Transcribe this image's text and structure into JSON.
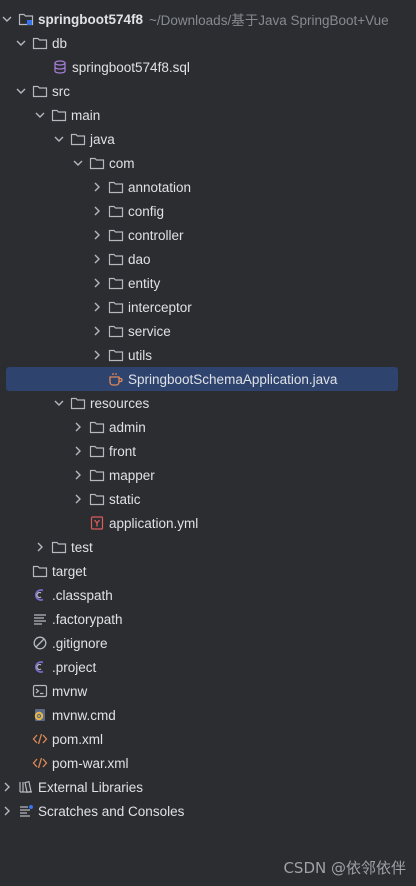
{
  "project": {
    "name": "springboot574f8",
    "path": "~/Downloads/基于Java SpringBoot+Vue"
  },
  "tree": {
    "db": "db",
    "sql_file": "springboot574f8.sql",
    "src": "src",
    "main": "main",
    "java": "java",
    "com": "com",
    "annotation": "annotation",
    "config": "config",
    "controller": "controller",
    "dao": "dao",
    "entity": "entity",
    "interceptor": "interceptor",
    "service": "service",
    "utils": "utils",
    "app_class": "SpringbootSchemaApplication.java",
    "resources": "resources",
    "admin": "admin",
    "front": "front",
    "mapper": "mapper",
    "static": "static",
    "app_yml": "application.yml",
    "test": "test",
    "target": "target",
    "classpath": ".classpath",
    "factorypath": ".factorypath",
    "gitignore": ".gitignore",
    "project_file": ".project",
    "mvnw": "mvnw",
    "mvnw_cmd": "mvnw.cmd",
    "pom": "pom.xml",
    "pom_war": "pom-war.xml"
  },
  "external_libraries": "External Libraries",
  "scratches": "Scratches and Consoles",
  "watermark": "CSDN @依邻依伴",
  "colors": {
    "background": "#2b2d30",
    "selection": "#2e436e",
    "text": "#dfe1e5",
    "muted": "#868a91"
  }
}
